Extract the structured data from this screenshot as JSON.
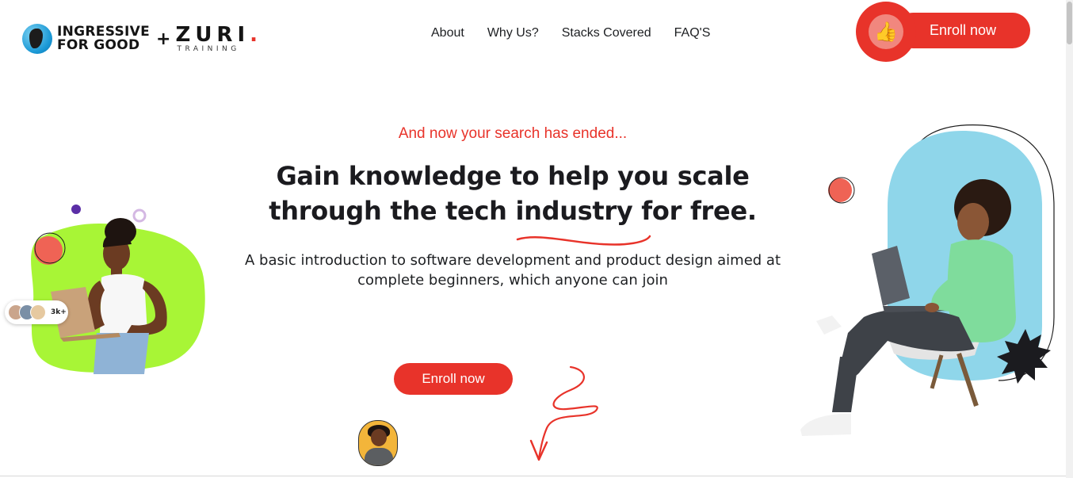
{
  "header": {
    "logo_primary_line1": "INGRESSIVE",
    "logo_primary_line2": "FOR GOOD",
    "logo_plus": "+",
    "logo_secondary": "ZURI",
    "logo_secondary_dot": ".",
    "logo_secondary_sub": "TRAINING",
    "nav": [
      {
        "label": "About"
      },
      {
        "label": "Why Us?"
      },
      {
        "label": "Stacks Covered"
      },
      {
        "label": "FAQ'S"
      }
    ],
    "enroll_label": "Enroll now",
    "enroll_icon": "thumbs-up-icon"
  },
  "hero": {
    "tagline": "And now your search has ended...",
    "headline_line1": "Gain knowledge to help you scale",
    "headline_line2": "through the tech industry for free.",
    "subtext_line1": "A basic introduction to software development and product design aimed at",
    "subtext_line2": "complete beginners, which anyone can join",
    "cta_label": "Enroll now",
    "students_badge": "3k+"
  },
  "colors": {
    "accent": "#e8332a",
    "accent_light": "#f1877e",
    "lime": "#a8f536",
    "sky": "#8fd6ea",
    "text": "#1d1f22"
  }
}
